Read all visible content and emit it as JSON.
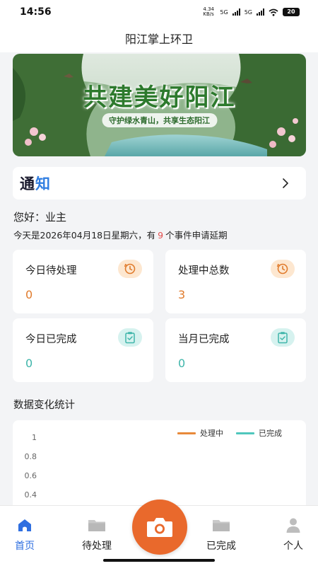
{
  "status_bar": {
    "time": "14:56",
    "net_speed": "4.34 KB/s",
    "network_1": "5G",
    "network_2": "5G",
    "battery": "20"
  },
  "app_title": "阳江掌上环卫",
  "banner": {
    "title": "共建美好阳江",
    "subtitle": "守护绿水青山，共享生态阳江"
  },
  "notice": {
    "title_part1": "通",
    "title_part2": "知",
    "chevron": "›"
  },
  "greeting": "您好：业主",
  "today_line": {
    "prefix": "今天是2026年04月18日星期六，有",
    "count": "9",
    "suffix": "个事件申请延期"
  },
  "stats": [
    {
      "label": "今日待处理",
      "value": "0",
      "icon": "clock-refresh-icon",
      "color": "#e07b2c"
    },
    {
      "label": "处理中总数",
      "value": "3",
      "icon": "clock-refresh-icon",
      "color": "#e07b2c"
    },
    {
      "label": "今日已完成",
      "value": "0",
      "icon": "clipboard-check-icon",
      "color": "#3fb5aa"
    },
    {
      "label": "当月已完成",
      "value": "0",
      "icon": "clipboard-check-icon",
      "color": "#3fb5aa"
    }
  ],
  "chart_section_title": "数据变化统计",
  "chart_data": {
    "type": "line",
    "series": [
      {
        "name": "处理中",
        "color": "#e8893a",
        "values": []
      },
      {
        "name": "已完成",
        "color": "#4fc7bd",
        "values": []
      }
    ],
    "y_ticks": [
      "1",
      "0.8",
      "0.6",
      "0.4"
    ],
    "ylim": [
      0,
      1
    ],
    "legend_position": "top-right"
  },
  "tabs": [
    {
      "label": "首页",
      "icon": "home-icon",
      "active": true
    },
    {
      "label": "待处理",
      "icon": "folder-icon",
      "active": false
    },
    {
      "label": "已完成",
      "icon": "folder-icon",
      "active": false
    },
    {
      "label": "个人",
      "icon": "person-icon",
      "active": false
    }
  ],
  "colors": {
    "accent_blue": "#2f6fe0",
    "orange": "#e07b2c",
    "teal": "#3fb5aa",
    "camera": "#e9692c"
  }
}
